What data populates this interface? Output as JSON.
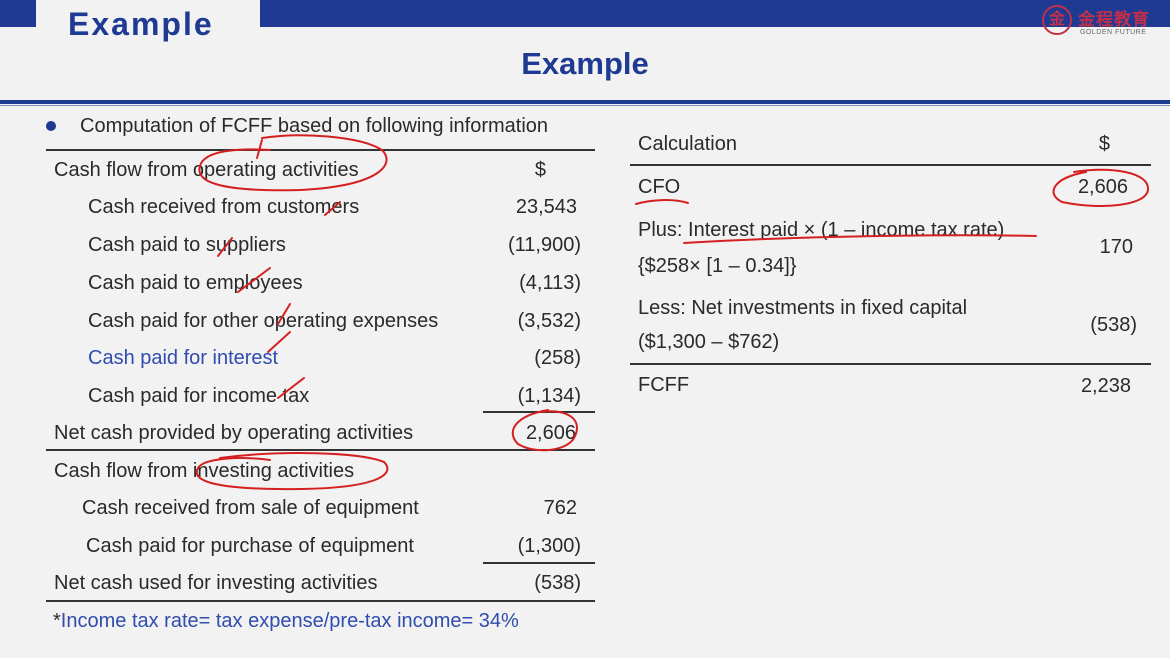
{
  "header": {
    "tab_title": "Example",
    "slide_title": "Example",
    "logo": {
      "name_cn": "金程教育",
      "name_en": "GOLDEN FUTURE"
    }
  },
  "left": {
    "intro": "Computation of FCFF based on following information",
    "rows": [
      {
        "label": "Cash flow from operating activities",
        "value": "$"
      },
      {
        "label": "Cash received from customers",
        "value": "23,543"
      },
      {
        "label": "Cash paid to suppliers",
        "value": "(11,900)"
      },
      {
        "label": "Cash paid to employees",
        "value": "(4,113)"
      },
      {
        "label": "Cash paid for other operating expenses",
        "value": "(3,532)"
      },
      {
        "label": "Cash paid for interest",
        "value": "(258)"
      },
      {
        "label": "Cash paid for income tax",
        "value": "(1,134)"
      },
      {
        "label": "Net cash provided by operating activities",
        "value": "2,606"
      },
      {
        "label": "Cash flow from investing activities",
        "value": ""
      },
      {
        "label": "Cash received from sale of equipment",
        "value": "762"
      },
      {
        "label": "Cash paid for purchase of equipment",
        "value": "(1,300)"
      },
      {
        "label": "Net cash used for investing activities",
        "value": "(538)"
      }
    ],
    "footnote_star": "*",
    "footnote": "Income tax rate= tax expense/pre-tax income= 34%"
  },
  "right": {
    "header_label": "Calculation",
    "header_value": "$",
    "cfo_label": "CFO",
    "cfo_value": "2,606",
    "plus_prefix": "Plus: ",
    "plus_label": "Interest paid × (1 – income tax rate)",
    "plus_formula": "{$258× [1 – 0.34]}",
    "plus_value": "170",
    "less_label": "Less: Net investments in fixed capital",
    "less_formula": "($1,300 – $762)",
    "less_value": "(538)",
    "fcff_label": "FCFF",
    "fcff_value": "2,238"
  }
}
